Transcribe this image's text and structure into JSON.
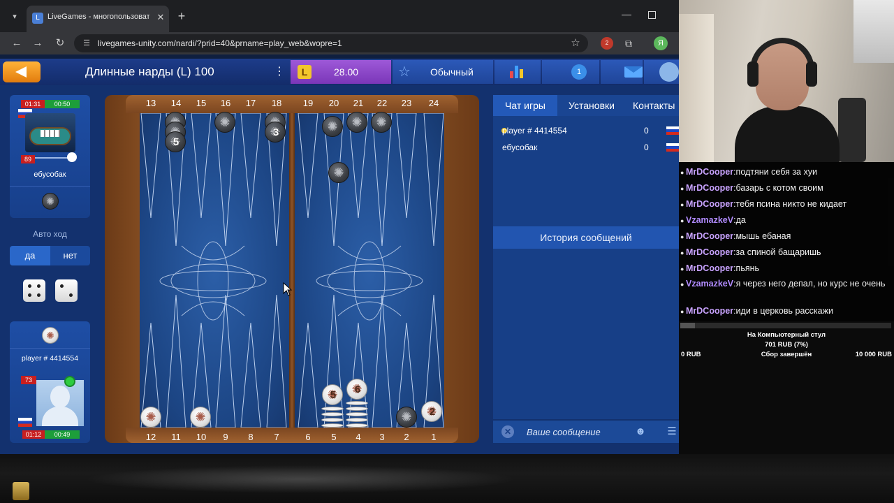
{
  "browser": {
    "tab_title": "LiveGames - многопользовате",
    "url": "livegames-unity.com/nardi/?prid=40&prname=play_web&wopre=1",
    "profile_letter": "Я",
    "ext_badge": "2"
  },
  "gamebar": {
    "title": "Длинные нарды (L) 100",
    "balance": "28.00",
    "mode": "Обычный",
    "notifications": "1"
  },
  "opponent": {
    "name": "ебусобак",
    "timer_left": "01:31",
    "timer_right": "00:50",
    "rating": "89"
  },
  "player": {
    "name": "player # 4414554",
    "rating": "73",
    "timer_left": "01:12",
    "timer_right": "00:49"
  },
  "auto_move": {
    "label": "Авто ход",
    "yes": "да",
    "no": "нет"
  },
  "dice": [
    4,
    2
  ],
  "board": {
    "top_points": [
      "13",
      "14",
      "15",
      "16",
      "17",
      "18",
      "19",
      "20",
      "21",
      "22",
      "23",
      "24"
    ],
    "bottom_points": [
      "12",
      "11",
      "10",
      "9",
      "8",
      "7",
      "6",
      "5",
      "4",
      "3",
      "2",
      "1"
    ],
    "stack_labels": {
      "p14": "5",
      "p18": "3",
      "p5": "5",
      "p4": "6",
      "p1": "2"
    }
  },
  "chat": {
    "tabs": [
      "Чат игры",
      "Установки",
      "Контакты"
    ],
    "players": [
      {
        "name": "player # 4414554",
        "score": "0"
      },
      {
        "name": "ебусобак",
        "score": "0"
      }
    ],
    "history_title": "История сообщений",
    "input_placeholder": "Ваше сообщение"
  },
  "stream_chat": [
    {
      "user": "MrDCooper",
      "text": "подтяни себя за хуи",
      "color": "#c9a3ff"
    },
    {
      "user": "MrDCooper",
      "text": "базарь с котом своим",
      "color": "#c9a3ff"
    },
    {
      "user": "MrDCooper",
      "text": "тебя псина никто не кидает",
      "color": "#c9a3ff"
    },
    {
      "user": "VzamazkeV",
      "text": "да",
      "color": "#b28cff"
    },
    {
      "user": "MrDCooper",
      "text": "мышь ебаная",
      "color": "#c9a3ff"
    },
    {
      "user": "MrDCooper",
      "text": "за спиной бащаришь",
      "color": "#c9a3ff"
    },
    {
      "user": "MrDCooper",
      "text": "пьянь",
      "color": "#c9a3ff"
    },
    {
      "user": "VzamazkeV",
      "text": "я через него депал, но курс не очень",
      "color": "#b28cff"
    },
    {
      "user": "MrDCooper",
      "text": "иди в церковь расскажи",
      "color": "#c9a3ff"
    }
  ],
  "donation": {
    "title": "На Компьютерный стул",
    "amount": "701 RUB (7%)",
    "min": "0 RUB",
    "status": "Сбор завершён",
    "max": "10 000 RUB",
    "progress": 0.07
  },
  "colors": {
    "accent_orange": "#f39a1f",
    "balance_purple": "#8a44c8",
    "board_blue": "#1c4584",
    "wood": "#8f5426"
  }
}
